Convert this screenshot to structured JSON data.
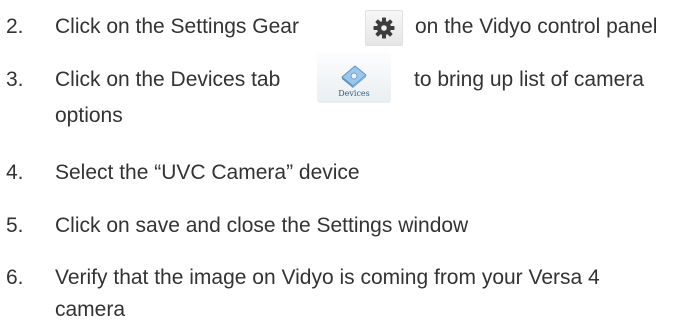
{
  "steps": [
    {
      "number": "2.",
      "text_before": "Click on the Settings Gear",
      "icon": "gear-icon",
      "text_after": "on the Vidyo control panel"
    },
    {
      "number": "3.",
      "text_before": "Click on the Devices tab",
      "icon": "devices-tab-icon",
      "icon_label": "Devices",
      "text_after": "to bring up list of camera",
      "text_line2": "options"
    },
    {
      "number": "4.",
      "text": "Select the “UVC Camera” device"
    },
    {
      "number": "5.",
      "text": "Click on save and close the Settings window"
    },
    {
      "number": "6.",
      "text": "Verify that the image on Vidyo is coming from your Versa 4",
      "text_line2": "camera"
    }
  ],
  "colors": {
    "text": "#333333",
    "gear": "#3d3d3d",
    "devices_blue": "#6aa6d8"
  }
}
